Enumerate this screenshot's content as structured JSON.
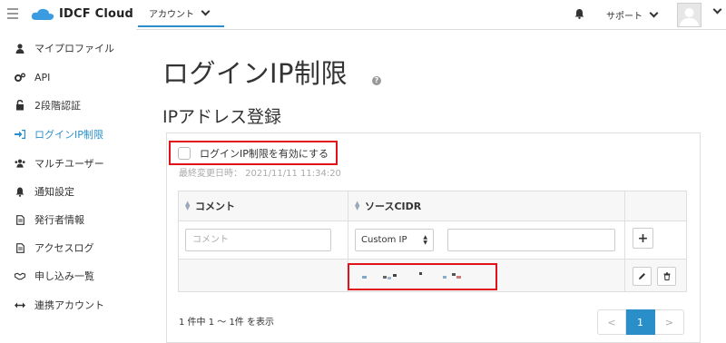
{
  "header": {
    "logo_text": "IDCF Cloud",
    "account_tab": "アカウント",
    "support_label": "サポート"
  },
  "sidebar": {
    "items": [
      {
        "label": "マイプロファイル",
        "icon": "user-icon"
      },
      {
        "label": "API",
        "icon": "gears-icon"
      },
      {
        "label": "2段階認証",
        "icon": "unlock-icon"
      },
      {
        "label": "ログインIP制限",
        "icon": "sign-in-icon",
        "active": true
      },
      {
        "label": "マルチユーザー",
        "icon": "users-icon"
      },
      {
        "label": "通知設定",
        "icon": "bell-icon"
      },
      {
        "label": "発行者情報",
        "icon": "document-icon"
      },
      {
        "label": "アクセスログ",
        "icon": "document-icon"
      },
      {
        "label": "申し込み一覧",
        "icon": "handshake-icon"
      },
      {
        "label": "連携アカウント",
        "icon": "arrows-h-icon"
      }
    ]
  },
  "main": {
    "title": "ログインIP制限",
    "section_title": "IPアドレス登録",
    "enable_label": "ログインIP制限を有効にする",
    "enable_checked": false,
    "last_modified_label": "最終変更日時：",
    "last_modified_value": "2021/11/11 11:34:20",
    "table": {
      "col_comment": "コメント",
      "col_cidr": "ソースCIDR",
      "comment_placeholder": "コメント",
      "cidr_select_value": "Custom IP",
      "cidr_input_value": ""
    },
    "pagination": {
      "summary": "1 件中 1 〜 1件 を表示",
      "prev": "<",
      "current": "1",
      "next": ">"
    }
  },
  "colors": {
    "accent": "#2a8fc9",
    "highlight_red": "#e2121b"
  }
}
